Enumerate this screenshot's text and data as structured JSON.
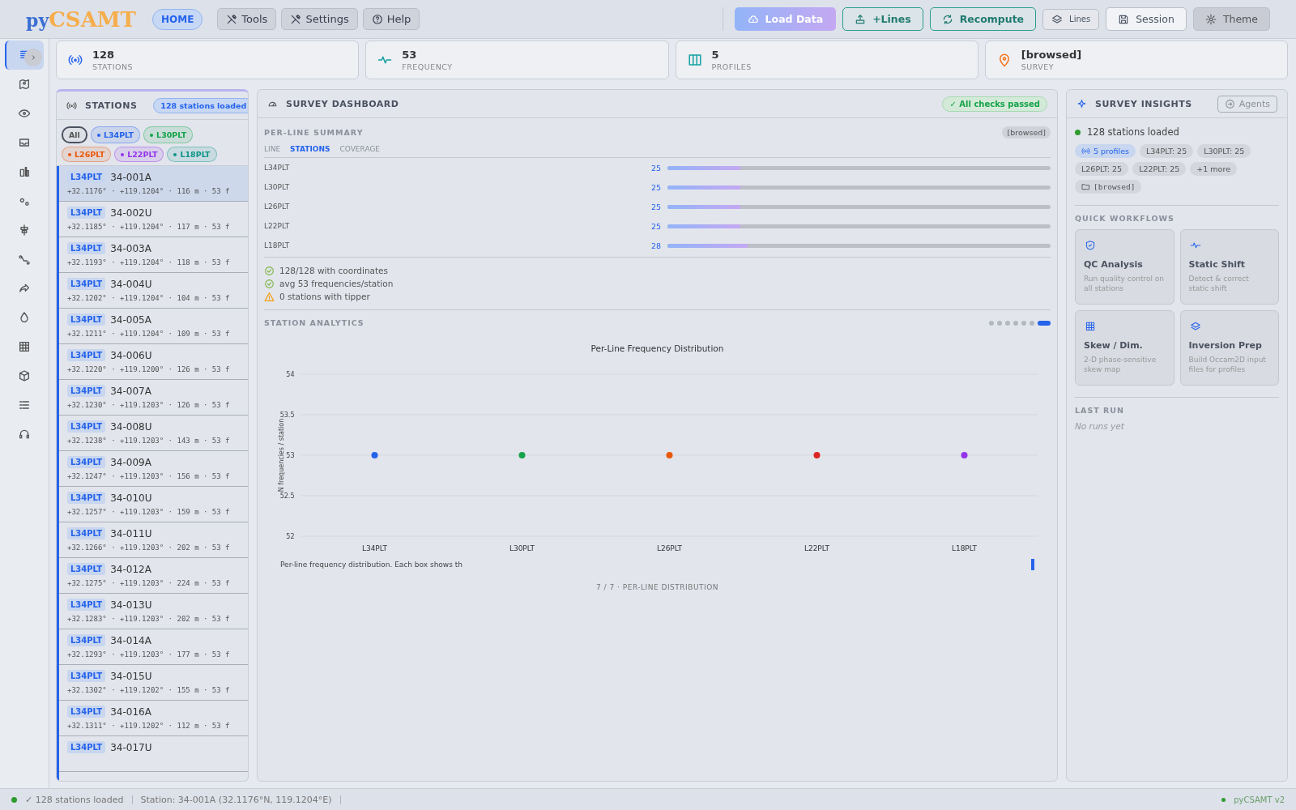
{
  "header": {
    "logo_prefix": "py",
    "logo_main": "CSAMT",
    "nav": [
      {
        "label": "HOME",
        "selected": true
      },
      {
        "label": "Tools",
        "selected": false
      },
      {
        "label": "Settings",
        "selected": false
      },
      {
        "label": "Help",
        "selected": false
      }
    ],
    "actions": [
      {
        "label": "Load Data",
        "kind": "gradient"
      },
      {
        "label": "+Lines",
        "kind": "teal"
      },
      {
        "label": "Recompute",
        "kind": "teal"
      },
      {
        "label": "Lines",
        "kind": "small"
      },
      {
        "label": "Session",
        "kind": "light"
      },
      {
        "label": "Theme",
        "kind": "dark"
      }
    ]
  },
  "rail": {
    "items": [
      {
        "selected": true
      },
      {
        "selected": false
      },
      {
        "selected": false
      },
      {
        "selected": false
      },
      {
        "selected": false
      },
      {
        "selected": false
      },
      {
        "selected": false
      },
      {
        "selected": false
      },
      {
        "selected": false
      },
      {
        "selected": false
      },
      {
        "selected": false
      },
      {
        "selected": false
      },
      {
        "selected": false
      },
      {
        "selected": false
      }
    ]
  },
  "stats": [
    {
      "value": "128",
      "label": "STATIONS"
    },
    {
      "value": "53",
      "label": "FREQUENCY"
    },
    {
      "value": "5",
      "label": "PROFILES"
    },
    {
      "value": "[browsed]",
      "label": "SURVEY"
    }
  ],
  "stations": {
    "title": "STATIONS",
    "badge": "128 stations loaded",
    "filters": [
      {
        "label": "All",
        "selected": true
      },
      {
        "label": "L34PLT",
        "selected": false,
        "color": "#2563eb"
      },
      {
        "label": "L30PLT",
        "selected": false,
        "color": "#16a34a"
      },
      {
        "label": "L26PLT",
        "selected": false,
        "color": "#ea580c"
      },
      {
        "label": "L22PLT",
        "selected": false,
        "color": "#9333ea"
      },
      {
        "label": "L18PLT",
        "selected": false,
        "color": "#0d9488"
      }
    ],
    "items": [
      {
        "line": "L34PLT",
        "name": "34-001A",
        "meta": "+32.1176° · +119.1204° · 116 m · 53 f",
        "selected": true
      },
      {
        "line": "L34PLT",
        "name": "34-002U",
        "meta": "+32.1185° · +119.1204° · 117 m · 53 f",
        "selected": false
      },
      {
        "line": "L34PLT",
        "name": "34-003A",
        "meta": "+32.1193° · +119.1204° · 118 m · 53 f",
        "selected": false
      },
      {
        "line": "L34PLT",
        "name": "34-004U",
        "meta": "+32.1202° · +119.1204° · 104 m · 53 f",
        "selected": false
      },
      {
        "line": "L34PLT",
        "name": "34-005A",
        "meta": "+32.1211° · +119.1204° · 109 m · 53 f",
        "selected": false
      },
      {
        "line": "L34PLT",
        "name": "34-006U",
        "meta": "+32.1220° · +119.1200° · 126 m · 53 f",
        "selected": false
      },
      {
        "line": "L34PLT",
        "name": "34-007A",
        "meta": "+32.1230° · +119.1203° · 126 m · 53 f",
        "selected": false
      },
      {
        "line": "L34PLT",
        "name": "34-008U",
        "meta": "+32.1238° · +119.1203° · 143 m · 53 f",
        "selected": false
      },
      {
        "line": "L34PLT",
        "name": "34-009A",
        "meta": "+32.1247° · +119.1203° · 156 m · 53 f",
        "selected": false
      },
      {
        "line": "L34PLT",
        "name": "34-010U",
        "meta": "+32.1257° · +119.1203° · 159 m · 53 f",
        "selected": false
      },
      {
        "line": "L34PLT",
        "name": "34-011U",
        "meta": "+32.1266° · +119.1203° · 202 m · 53 f",
        "selected": false
      },
      {
        "line": "L34PLT",
        "name": "34-012A",
        "meta": "+32.1275° · +119.1203° · 224 m · 53 f",
        "selected": false
      },
      {
        "line": "L34PLT",
        "name": "34-013U",
        "meta": "+32.1283° · +119.1203° · 202 m · 53 f",
        "selected": false
      },
      {
        "line": "L34PLT",
        "name": "34-014A",
        "meta": "+32.1293° · +119.1203° · 177 m · 53 f",
        "selected": false
      },
      {
        "line": "L34PLT",
        "name": "34-015U",
        "meta": "+32.1302° · +119.1202° · 155 m · 53 f",
        "selected": false
      },
      {
        "line": "L34PLT",
        "name": "34-016A",
        "meta": "+32.1311° · +119.1202° · 112 m · 53 f",
        "selected": false
      },
      {
        "line": "L34PLT",
        "name": "34-017U",
        "selected": false
      }
    ]
  },
  "dashboard": {
    "title": "SURVEY DASHBOARD",
    "status": "✓ All checks passed",
    "summary": {
      "title": "PER-LINE SUMMARY",
      "tag": "[browsed]",
      "columns": [
        "LINE",
        "STATIONS",
        "COVERAGE"
      ],
      "rows": [
        {
          "line": "L34PLT",
          "count": "25",
          "level": 0.19
        },
        {
          "line": "L30PLT",
          "count": "25",
          "level": 0.19
        },
        {
          "line": "L26PLT",
          "count": "25",
          "level": 0.19
        },
        {
          "line": "L22PLT",
          "count": "25",
          "level": 0.19
        },
        {
          "line": "L18PLT",
          "count": "28",
          "level": 0.21
        }
      ],
      "checks": [
        {
          "text": "128/128 with coordinates",
          "kind": "ok"
        },
        {
          "text": "avg 53 frequencies/station",
          "kind": "ok"
        },
        {
          "text": "0 stations with tipper",
          "kind": "warn"
        }
      ]
    },
    "analytics": {
      "title": "STATION ANALYTICS",
      "pages": [
        {
          "selected": false
        },
        {
          "selected": false
        },
        {
          "selected": false
        },
        {
          "selected": false
        },
        {
          "selected": false
        },
        {
          "selected": false
        },
        {
          "selected": true
        }
      ],
      "chart_data": {
        "type": "scatter",
        "title": "Per-Line Frequency Distribution",
        "ylabel": "N frequencies / station",
        "categories": [
          "L34PLT",
          "L30PLT",
          "L26PLT",
          "L22PLT",
          "L18PLT"
        ],
        "ylim": [
          52,
          54
        ],
        "yticks": [
          52,
          52.5,
          53,
          53.5,
          54
        ],
        "grid": true,
        "values": [
          53,
          53,
          53,
          53,
          53
        ]
      },
      "caption": "Per-line frequency distribution. Each box shows th",
      "footer": "7 / 7 · PER-LINE DISTRIBUTION"
    }
  },
  "insights": {
    "title": "SURVEY INSIGHTS",
    "agents": "Agents",
    "status": "128 stations loaded",
    "chips": [
      {
        "text": "5 profiles",
        "kind": "profiles"
      },
      {
        "text": "L34PLT: 25",
        "kind": "plain"
      },
      {
        "text": "L30PLT: 25",
        "kind": "plain"
      },
      {
        "text": "L26PLT: 25",
        "kind": "plain"
      },
      {
        "text": "L22PLT: 25",
        "kind": "plain"
      },
      {
        "text": "+1 more",
        "kind": "plain"
      },
      {
        "text": "[browsed]",
        "kind": "folder"
      }
    ],
    "workflows_title": "QUICK WORKFLOWS",
    "workflows": [
      {
        "title": "QC Analysis",
        "desc": "Run quality control on all stations"
      },
      {
        "title": "Static Shift",
        "desc": "Detect & correct static shift"
      },
      {
        "title": "Skew / Dim.",
        "desc": "2-D phase-sensitive skew map"
      },
      {
        "title": "Inversion Prep",
        "desc": "Build Occam2D input files for profiles"
      }
    ],
    "last_run_title": "LAST RUN",
    "last_run": "No runs yet"
  },
  "status_bar": {
    "items": [
      "✓ 128 stations loaded",
      "Station: 34-001A (32.1176°N, 119.1204°E)"
    ],
    "version": "pyCSAMT v2"
  }
}
